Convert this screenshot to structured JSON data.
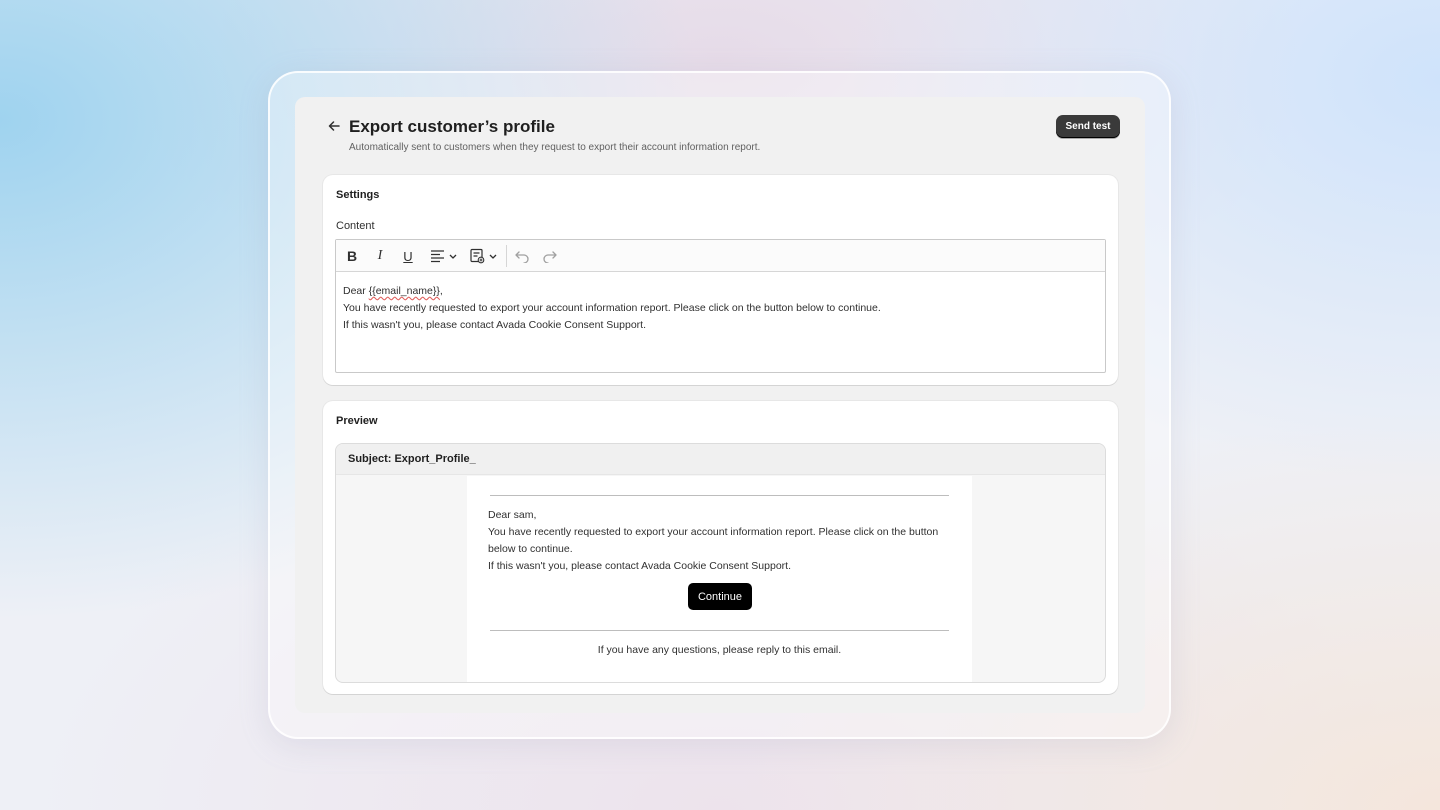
{
  "header": {
    "title": "Export customer’s profile",
    "subtitle": "Automatically sent to customers when they request to export their account information report.",
    "send_test_label": "Send test"
  },
  "settings": {
    "title": "Settings",
    "content_label": "Content",
    "toolbar": {
      "bold": "B",
      "italic": "I",
      "underline": "U"
    },
    "editor": {
      "greeting_prefix": "Dear ",
      "greeting_variable": "{{email_name}}",
      "greeting_suffix": ",",
      "line2": "You have recently requested to export your account information report. Please click on the button below to continue.",
      "line3": "If this wasn't you, please contact Avada Cookie Consent Support."
    }
  },
  "preview": {
    "title": "Preview",
    "subject": "Subject: Export_Profile_",
    "email": {
      "greeting": "Dear sam,",
      "line2": "You have recently requested to export your account information report. Please click on the button below to continue.",
      "line3": "If this wasn't you, please contact Avada Cookie Consent Support.",
      "button_label": "Continue",
      "footer": "If you have any questions, please reply to this email."
    }
  },
  "icons": {
    "back": "arrow-left-icon",
    "align": "align-left-icon",
    "insert": "insert-variable-icon",
    "undo": "undo-icon",
    "redo": "redo-icon"
  },
  "colors": {
    "primary_button": "#3a3a3a",
    "continue_button": "#000000",
    "app_background": "#f1f1f1"
  }
}
